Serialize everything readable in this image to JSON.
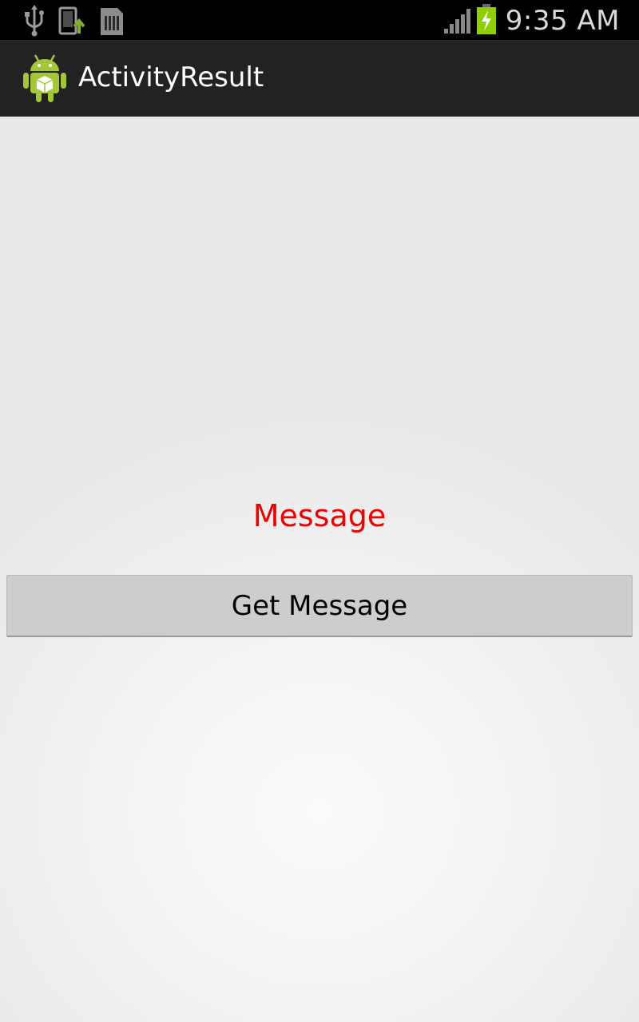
{
  "status_bar": {
    "time": "9:35 AM",
    "icons": [
      "usb-icon",
      "phone-upload-icon",
      "sd-card-icon",
      "signal-icon",
      "battery-charging-icon"
    ],
    "battery_color": "#8fce00"
  },
  "action_bar": {
    "title": "ActivityResult",
    "icon": "android-icon",
    "icon_color": "#a4c639"
  },
  "main": {
    "message_text": "Message",
    "message_color": "#ee0000",
    "button_label": "Get Message"
  }
}
